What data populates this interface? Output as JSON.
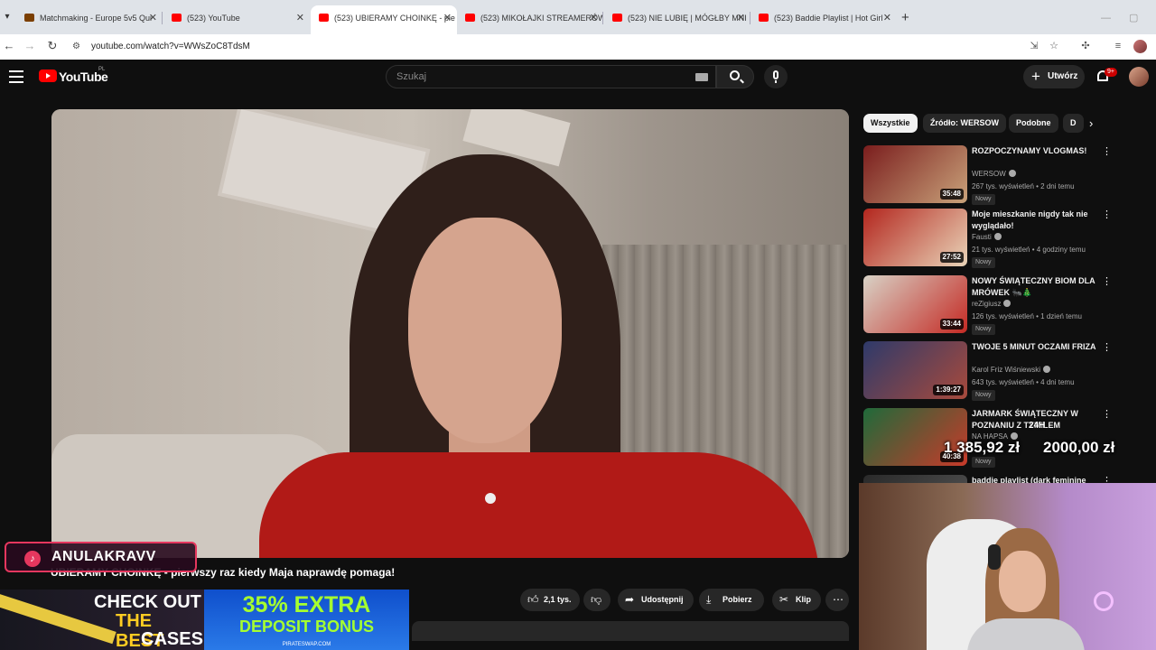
{
  "browser": {
    "tabs": [
      {
        "title": "Matchmaking - Europe 5v5 Qui"
      },
      {
        "title": "(523) YouTube"
      },
      {
        "title": "(523) UBIERAMY CHOINKĘ - pie",
        "active": true
      },
      {
        "title": "(523) MIKOŁAJKI STREAMERÓW"
      },
      {
        "title": "(523) NIE LUBIĘ | MÓGŁBY MNI"
      },
      {
        "title": "(523) Baddie Playlist | Hot Girl"
      }
    ],
    "url": "youtube.com/watch?v=WWsZoC8TdsM"
  },
  "youtube": {
    "logo": "YouTube",
    "country": "PL",
    "search_placeholder": "Szukaj",
    "create_label": "Utwórz",
    "notif_count": "9+"
  },
  "video": {
    "title": "UBIERAMY CHOINKĘ - pierwszy raz kiedy Maja naprawdę pomaga!",
    "likes": "2,1 tys.",
    "share_label": "Udostępnij",
    "download_label": "Pobierz",
    "clip_label": "Klip"
  },
  "chips": [
    "Wszystkie",
    "Źródło: WERSOW",
    "Podobne",
    "D"
  ],
  "recommendations": [
    {
      "title": "ROZPOCZYNAMY VLOGMAS!",
      "channel": "WERSOW",
      "meta": "267 tys. wyświetleń • 2 dni temu",
      "badge": "Nowy",
      "duration": "35:48",
      "colors": [
        "#7a1d1d",
        "#c9a27a"
      ]
    },
    {
      "title": "Moje mieszkanie nigdy tak nie wyglądało!",
      "channel": "Fausti",
      "meta": "21 tys. wyświetleń • 4 godziny temu",
      "badge": "Nowy",
      "duration": "27:52",
      "colors": [
        "#b3261e",
        "#e9d4b8"
      ]
    },
    {
      "title": "NOWY ŚWIĄTECZNY BIOM DLA MRÓWEK 🐜🎄",
      "channel": "reZigiusz",
      "meta": "126 tys. wyświetleń • 1 dzień temu",
      "badge": "Nowy",
      "duration": "33:44",
      "colors": [
        "#d8d2c6",
        "#c42a24"
      ]
    },
    {
      "title": "TWOJE 5 MINUT OCZAMI FRIZA",
      "channel": "Karol Friz Wiśniewski",
      "meta": "643 tys. wyświetleń • 4 dni temu",
      "badge": "Nowy",
      "duration": "1:39:27",
      "colors": [
        "#2e3a6a",
        "#a84a3c"
      ]
    },
    {
      "title": "JARMARK ŚWIĄTECZNY W POZNANIU Z TYMILEM",
      "channel": "NA HAPSA",
      "meta": "",
      "badge": "Nowy",
      "duration": "40:38",
      "colors": [
        "#1f6a3a",
        "#c83a2a"
      ]
    },
    {
      "title": "baddie playlist (dark feminine",
      "channel": "",
      "meta": "",
      "badge": "",
      "duration": "",
      "colors": [
        "#2a2a2a",
        "#555555"
      ]
    }
  ],
  "overlay": {
    "tiktok_name": "ANULAKRAVV",
    "ad_left": [
      "CHECK OUT",
      "THE BEST",
      "CASES"
    ],
    "ad_right": [
      "35% EXTRA",
      "DEPOSIT BONUS",
      "PIRATESWAP.COM"
    ],
    "goal_label": "24H",
    "goal_current": "1 385,92 zł",
    "goal_target": "2000,00 zł"
  }
}
